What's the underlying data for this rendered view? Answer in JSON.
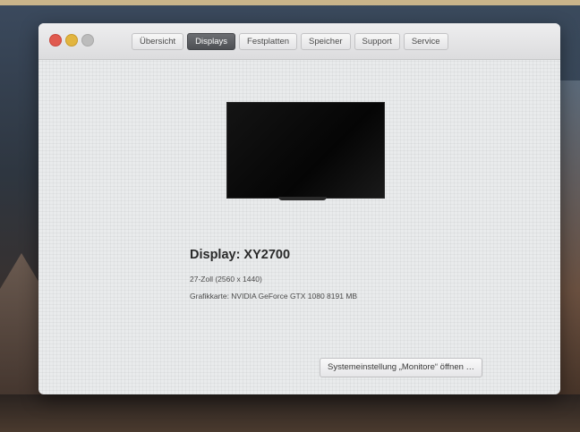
{
  "window": {
    "tabs": [
      {
        "label": "Übersicht"
      },
      {
        "label": "Displays"
      },
      {
        "label": "Festplatten"
      },
      {
        "label": "Speicher"
      },
      {
        "label": "Support"
      },
      {
        "label": "Service"
      }
    ],
    "active_tab": "Displays"
  },
  "display": {
    "name": "Display: XY2700",
    "size": "27-Zoll (2560 x 1440)",
    "gpu": "Grafikkarte: NVIDIA GeForce GTX 1080 8191 MB"
  },
  "actions": {
    "open_prefs_label": "Systemeinstellung „Monitore“ öffnen …"
  },
  "colors": {
    "close": "#e05a4f",
    "minimize": "#e2b53f",
    "active_tab": "#55575b"
  }
}
